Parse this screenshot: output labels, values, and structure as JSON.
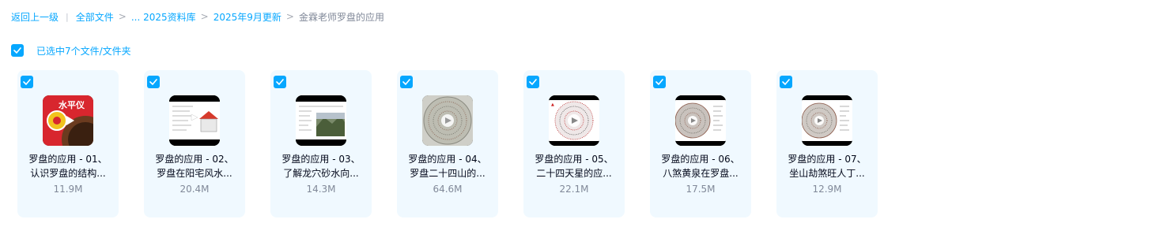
{
  "breadcrumb": {
    "back": "返回上一级",
    "all_files": "全部文件",
    "ellipsis_item": "... 2025资料库",
    "item_month": "2025年9月更新",
    "current": "金霖老师罗盘的应用"
  },
  "selection": {
    "label": "已选中7个文件/文件夹"
  },
  "files": [
    {
      "line1": "罗盘的应用 - 01、",
      "line2": "认识罗盘的结构...",
      "size": "11.9M",
      "thumb_text": "水平仪"
    },
    {
      "line1": "罗盘的应用 - 02、",
      "line2": "罗盘在阳宅风水...",
      "size": "20.4M"
    },
    {
      "line1": "罗盘的应用 - 03、",
      "line2": "了解龙穴砂水向...",
      "size": "14.3M"
    },
    {
      "line1": "罗盘的应用 - 04、",
      "line2": "罗盘二十四山的...",
      "size": "64.6M"
    },
    {
      "line1": "罗盘的应用 - 05、",
      "line2": "二十四天星的应...",
      "size": "22.1M"
    },
    {
      "line1": "罗盘的应用 - 06、",
      "line2": "八煞黄泉在罗盘...",
      "size": "17.5M"
    },
    {
      "line1": "罗盘的应用 - 07、",
      "line2": "坐山劫煞旺人丁...",
      "size": "12.9M"
    }
  ],
  "colors": {
    "accent": "#06a7ff",
    "card_bg": "#f0f9ff",
    "muted": "#818999"
  }
}
